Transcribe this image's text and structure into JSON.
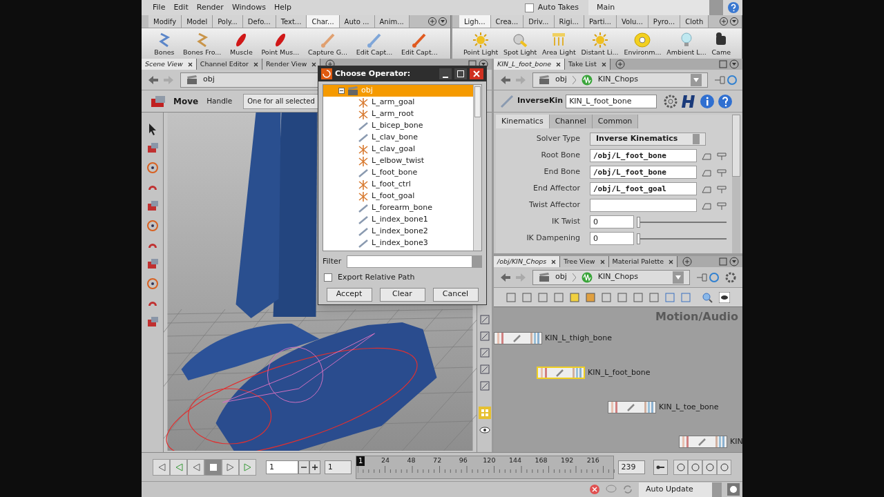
{
  "menu": [
    "File",
    "Edit",
    "Render",
    "Windows",
    "Help"
  ],
  "auto_takes": {
    "label": "Auto Takes",
    "checked": false
  },
  "take": "Main",
  "shelf_left": {
    "tabs": [
      {
        "label": "Modify",
        "selected": false
      },
      {
        "label": "Model",
        "selected": false
      },
      {
        "label": "Poly...",
        "selected": false
      },
      {
        "label": "Defo...",
        "selected": false
      },
      {
        "label": "Text...",
        "selected": false
      },
      {
        "label": "Char...",
        "selected": true
      },
      {
        "label": "Auto ...",
        "selected": false
      },
      {
        "label": "Anim...",
        "selected": false
      }
    ],
    "tools": [
      {
        "label": "Bones",
        "kind": "bone"
      },
      {
        "label": "Bones Fro...",
        "kind": "bone_curve"
      },
      {
        "label": "Muscle",
        "kind": "muscle"
      },
      {
        "label": "Point Mus...",
        "kind": "muscle"
      },
      {
        "label": "Capture G...",
        "kind": "capture"
      },
      {
        "label": "Edit Capt...",
        "kind": "capture_blue"
      },
      {
        "label": "Edit Capt...",
        "kind": "capture_red"
      }
    ]
  },
  "shelf_right": {
    "tabs": [
      {
        "label": "Ligh...",
        "selected": true
      },
      {
        "label": "Crea...",
        "selected": false
      },
      {
        "label": "Driv...",
        "selected": false
      },
      {
        "label": "Rigi...",
        "selected": false
      },
      {
        "label": "Parti...",
        "selected": false
      },
      {
        "label": "Volu...",
        "selected": false
      },
      {
        "label": "Pyro...",
        "selected": false
      },
      {
        "label": "Cloth",
        "selected": false
      }
    ],
    "tools": [
      {
        "label": "Point Light",
        "kind": "light"
      },
      {
        "label": "Spot Light",
        "kind": "spot"
      },
      {
        "label": "Area Light",
        "kind": "area"
      },
      {
        "label": "Distant Li...",
        "kind": "light"
      },
      {
        "label": "Environm...",
        "kind": "env"
      },
      {
        "label": "Ambient L...",
        "kind": "bulb"
      },
      {
        "label": "Came",
        "kind": "camera"
      }
    ]
  },
  "scene_view": {
    "tabs": [
      {
        "label": "Scene View",
        "selected": true
      },
      {
        "label": "Channel Editor",
        "selected": false
      },
      {
        "label": "Render View",
        "selected": false
      }
    ],
    "path": "obj",
    "tool": "Move",
    "handle_label": "Handle",
    "handle_mode": "One for all selected"
  },
  "dialog": {
    "title": "Choose Operator:",
    "tree": [
      {
        "label": "obj",
        "kind": "folder",
        "selected": true,
        "expanded": true,
        "children": [
          {
            "label": "L_arm_goal",
            "kind": "null",
            "selected": false
          },
          {
            "label": "L_arm_root",
            "kind": "null",
            "selected": false
          },
          {
            "label": "L_bicep_bone",
            "kind": "bone",
            "selected": false
          },
          {
            "label": "L_clav_bone",
            "kind": "bone",
            "selected": false
          },
          {
            "label": "L_clav_goal",
            "kind": "null",
            "selected": false
          },
          {
            "label": "L_elbow_twist",
            "kind": "null",
            "selected": false
          },
          {
            "label": "L_foot_bone",
            "kind": "bone",
            "selected": false
          },
          {
            "label": "L_foot_ctrl",
            "kind": "null",
            "selected": false
          },
          {
            "label": "L_foot_goal",
            "kind": "null",
            "selected": false
          },
          {
            "label": "L_forearm_bone",
            "kind": "bone",
            "selected": false
          },
          {
            "label": "L_index_bone1",
            "kind": "bone",
            "selected": false
          },
          {
            "label": "L_index_bone2",
            "kind": "bone",
            "selected": false
          },
          {
            "label": "L_index_bone3",
            "kind": "bone",
            "selected": false
          }
        ]
      }
    ],
    "filter_label": "Filter",
    "export_relative": {
      "label": "Export Relative Path",
      "checked": false
    },
    "buttons": [
      "Accept",
      "Clear",
      "Cancel"
    ]
  },
  "params": {
    "tabs": [
      {
        "label": "KIN_L_foot_bone",
        "selected": true
      },
      {
        "label": "Take List",
        "selected": false
      }
    ],
    "path": [
      "obj",
      "KIN_Chops"
    ],
    "node_type": "InverseKin",
    "node_name": "KIN_L_foot_bone",
    "param_tabs": [
      {
        "label": "Kinematics",
        "selected": true
      },
      {
        "label": "Channel",
        "selected": false
      },
      {
        "label": "Common",
        "selected": false
      }
    ],
    "rows": [
      {
        "kind": "menu",
        "label": "Solver Type",
        "value": "Inverse Kinematics"
      },
      {
        "kind": "path",
        "label": "Root Bone",
        "value": "/obj/L_foot_bone"
      },
      {
        "kind": "path",
        "label": "End Bone",
        "value": "/obj/L_foot_bone"
      },
      {
        "kind": "path",
        "label": "End Affector",
        "value": "/obj/L_foot_goal"
      },
      {
        "kind": "path",
        "label": "Twist Affector"
      },
      {
        "kind": "slider",
        "label": "IK Twist",
        "value": "0",
        "level": 0
      },
      {
        "kind": "slider",
        "label": "IK Dampening",
        "value": "0",
        "level": 0
      }
    ]
  },
  "network": {
    "tabs": [
      {
        "label": "/obj/KIN_Chops",
        "selected": true
      },
      {
        "label": "Tree View",
        "selected": false
      },
      {
        "label": "Material Palette",
        "selected": false
      }
    ],
    "path": [
      "obj",
      "KIN_Chops"
    ],
    "context": "Motion/Audio",
    "nodes": [
      {
        "name": "KIN_L_thigh_bone",
        "selected": false
      },
      {
        "name": "KIN_L_foot_bone",
        "selected": true
      },
      {
        "name": "KIN_L_toe_bone",
        "selected": false
      },
      {
        "name": "KIN",
        "selected": false
      }
    ]
  },
  "timeline": {
    "frame": "1",
    "start": "1",
    "current_marker": "1",
    "ticks": [
      "24",
      "48",
      "72",
      "96",
      "120",
      "144",
      "168",
      "192",
      "216"
    ],
    "end": "239"
  },
  "status": {
    "update_mode": "Auto Update"
  }
}
